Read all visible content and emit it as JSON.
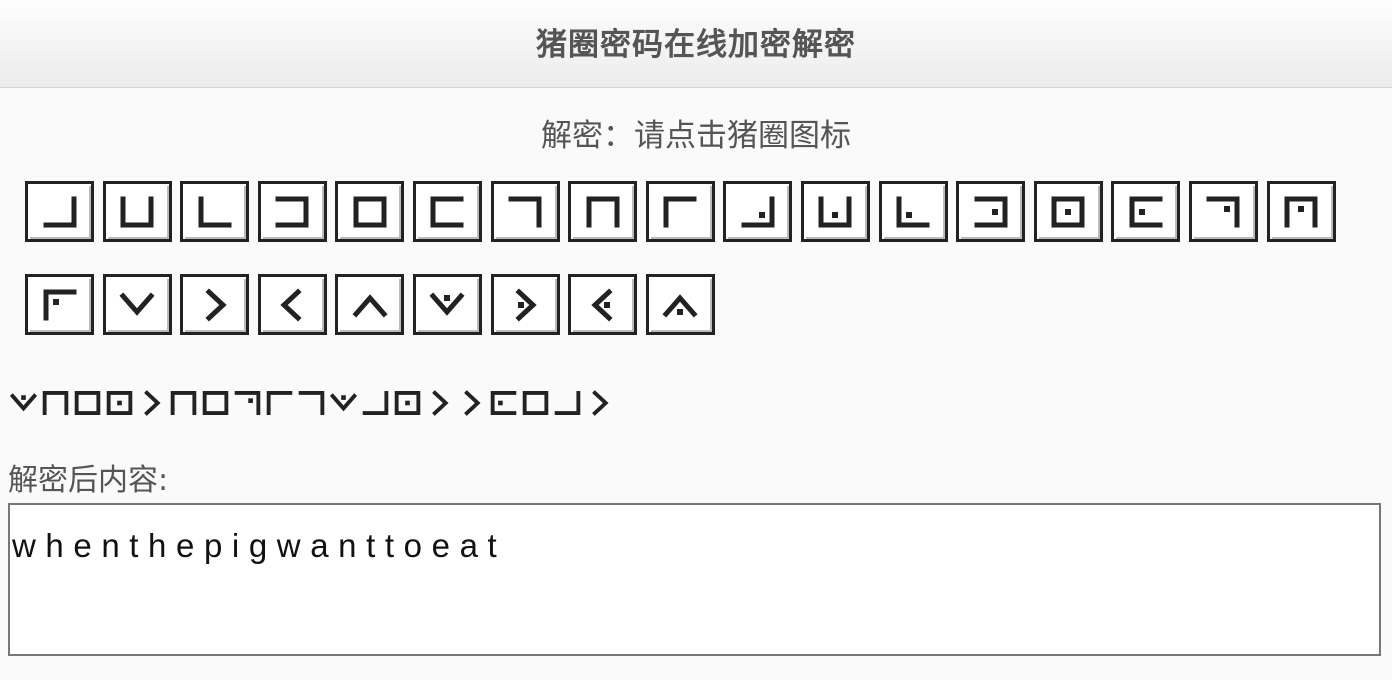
{
  "header": {
    "title": "猪圈密码在线加密解密"
  },
  "instruction": {
    "text": "解密：请点击猪圈图标"
  },
  "keypad": {
    "row1": [
      {
        "letter": "a",
        "icon": "pigpen-a-icon",
        "shape": "tl"
      },
      {
        "letter": "b",
        "icon": "pigpen-b-icon",
        "shape": "t"
      },
      {
        "letter": "c",
        "icon": "pigpen-c-icon",
        "shape": "tr"
      },
      {
        "letter": "d",
        "icon": "pigpen-d-icon",
        "shape": "l"
      },
      {
        "letter": "e",
        "icon": "pigpen-e-icon",
        "shape": "c"
      },
      {
        "letter": "f",
        "icon": "pigpen-f-icon",
        "shape": "r"
      },
      {
        "letter": "g",
        "icon": "pigpen-g-icon",
        "shape": "bl"
      },
      {
        "letter": "h",
        "icon": "pigpen-h-icon",
        "shape": "b"
      },
      {
        "letter": "i",
        "icon": "pigpen-i-icon",
        "shape": "br"
      },
      {
        "letter": "j",
        "icon": "pigpen-j-icon",
        "shape": "tl",
        "dot": true
      },
      {
        "letter": "k",
        "icon": "pigpen-k-icon",
        "shape": "t",
        "dot": true
      },
      {
        "letter": "l",
        "icon": "pigpen-l-icon",
        "shape": "tr",
        "dot": true
      },
      {
        "letter": "m",
        "icon": "pigpen-m-icon",
        "shape": "l",
        "dot": true
      },
      {
        "letter": "n",
        "icon": "pigpen-n-icon",
        "shape": "c",
        "dot": true
      },
      {
        "letter": "o",
        "icon": "pigpen-o-icon",
        "shape": "r",
        "dot": true
      },
      {
        "letter": "p",
        "icon": "pigpen-p-icon",
        "shape": "bl",
        "dot": true
      },
      {
        "letter": "q",
        "icon": "pigpen-q-icon",
        "shape": "b",
        "dot": true
      }
    ],
    "row2": [
      {
        "letter": "r",
        "icon": "pigpen-r-icon",
        "shape": "br",
        "dot": true
      },
      {
        "letter": "s",
        "icon": "pigpen-s-icon",
        "shape": "vt"
      },
      {
        "letter": "t",
        "icon": "pigpen-t-icon",
        "shape": "vl"
      },
      {
        "letter": "u",
        "icon": "pigpen-u-icon",
        "shape": "vr"
      },
      {
        "letter": "v",
        "icon": "pigpen-v-icon",
        "shape": "vb"
      },
      {
        "letter": "w",
        "icon": "pigpen-w-icon",
        "shape": "vt",
        "dot": true
      },
      {
        "letter": "x",
        "icon": "pigpen-x-icon",
        "shape": "vl",
        "dot": true
      },
      {
        "letter": "y",
        "icon": "pigpen-y-icon",
        "shape": "vr",
        "dot": true
      },
      {
        "letter": "z",
        "icon": "pigpen-z-icon",
        "shape": "vb",
        "dot": true
      }
    ]
  },
  "cipher": {
    "letters": [
      "w",
      "h",
      "e",
      "n",
      "t",
      "h",
      "e",
      "p",
      "i",
      "g",
      "w",
      "a",
      "n",
      "t",
      "t",
      "o",
      "e",
      "a",
      "t"
    ]
  },
  "result": {
    "label": "解密后内容:",
    "text": "whenthepigwanttoeat"
  }
}
